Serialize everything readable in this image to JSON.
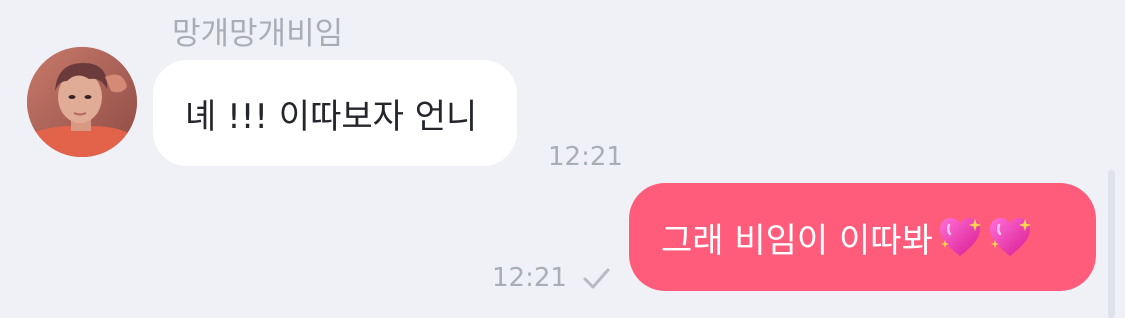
{
  "conversation": {
    "incoming": {
      "sender_name": "망개망개비임",
      "avatar_icon": "profile-photo",
      "text": "녜 !!! 이따보자 언니",
      "time": "12:21"
    },
    "outgoing": {
      "text": "그래 비임이 이따봐",
      "emojis": [
        "sparkling-heart",
        "sparkling-heart"
      ],
      "time": "12:21",
      "status_icon": "check-icon"
    }
  },
  "colors": {
    "background": "#eff1f6",
    "incoming_bubble": "#ffffff",
    "outgoing_bubble": "#ff5c7c",
    "meta_text": "#a9adb6"
  }
}
